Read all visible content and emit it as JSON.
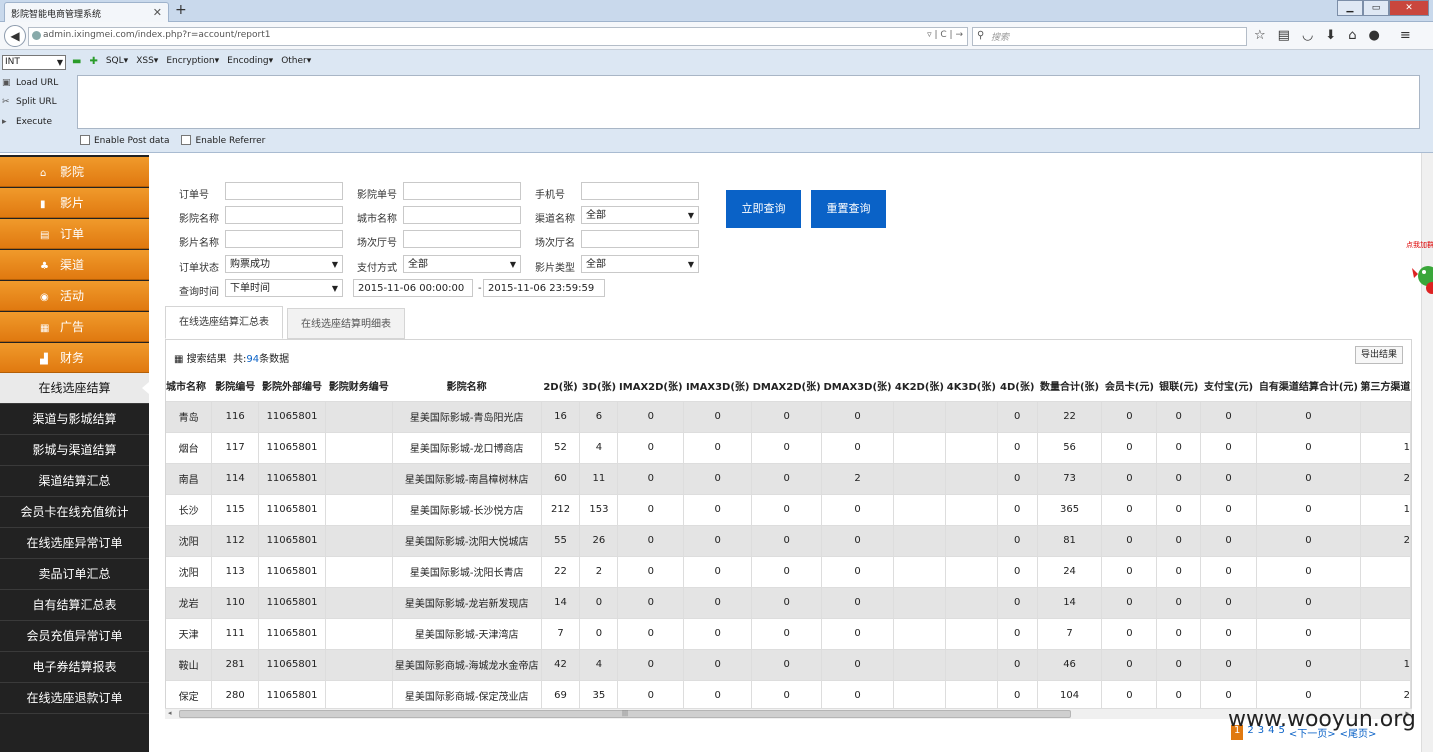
{
  "browser": {
    "tab_title": "影院智能电商管理系统",
    "url_host": "admin.ixingmei.com",
    "url_path": "/index.php?r=account/report1",
    "search_placeholder": "搜索"
  },
  "hackbar": {
    "type_select": "INT",
    "menu": [
      "SQL",
      "XSS",
      "Encryption",
      "Encoding",
      "Other"
    ],
    "actions": [
      "Load URL",
      "Split URL",
      "Execute"
    ],
    "checks": [
      "Enable Post data",
      "Enable Referrer"
    ]
  },
  "sidebar": {
    "categories": [
      {
        "label": "影院",
        "icon": "home-icon"
      },
      {
        "label": "影片",
        "icon": "film-icon"
      },
      {
        "label": "订单",
        "icon": "document-icon"
      },
      {
        "label": "渠道",
        "icon": "network-icon"
      },
      {
        "label": "活动",
        "icon": "target-icon"
      },
      {
        "label": "广告",
        "icon": "grid-icon"
      },
      {
        "label": "财务",
        "icon": "chart-icon"
      }
    ],
    "items": [
      "在线选座结算",
      "渠道与影城结算",
      "影城与渠道结算",
      "渠道结算汇总",
      "会员卡在线充值统计",
      "在线选座异常订单",
      "卖品订单汇总",
      "自有结算汇总表",
      "会员充值异常订单",
      "电子券结算报表",
      "在线选座退款订单"
    ],
    "active_index": 0
  },
  "filters": {
    "order_no": {
      "label": "订单号",
      "value": ""
    },
    "cinema_order_no": {
      "label": "影院单号",
      "value": ""
    },
    "phone": {
      "label": "手机号",
      "value": ""
    },
    "cinema_name": {
      "label": "影院名称",
      "value": ""
    },
    "city_name": {
      "label": "城市名称",
      "value": ""
    },
    "channel_name": {
      "label": "渠道名称",
      "value": "全部"
    },
    "film_name": {
      "label": "影片名称",
      "value": ""
    },
    "hall_no": {
      "label": "场次厅号",
      "value": ""
    },
    "hall_name": {
      "label": "场次厅名",
      "value": ""
    },
    "order_status": {
      "label": "订单状态",
      "value": "购票成功"
    },
    "pay_method": {
      "label": "支付方式",
      "value": "全部"
    },
    "film_type": {
      "label": "影片类型",
      "value": "全部"
    },
    "query_time": {
      "label": "查询时间",
      "value": "下单时间"
    },
    "time_from": "2015-11-06 00:00:00",
    "time_sep": "-",
    "time_to": "2015-11-06 23:59:59"
  },
  "buttons": {
    "query": "立即查询",
    "reset": "重置查询",
    "export": "导出结果"
  },
  "tabs": [
    "在线选座结算汇总表",
    "在线选座结算明细表"
  ],
  "result": {
    "label": "搜索结果",
    "count_prefix": "共:",
    "count": "94",
    "count_suffix": "条数据"
  },
  "table": {
    "headers": [
      "城市名称",
      "影院编号",
      "影院外部编号",
      "影院财务编号",
      "影院名称",
      "2D(张)",
      "3D(张)",
      "IMAX2D(张)",
      "IMAX3D(张)",
      "DMAX2D(张)",
      "DMAX3D(张)",
      "4K2D(张)",
      "4K3D(张)",
      "4D(张)",
      "数量合计(张)",
      "会员卡(元)",
      "银联(元)",
      "支付宝(元)",
      "自有渠道结算合计(元)",
      "第三方渠道"
    ],
    "rows": [
      [
        "青岛",
        "116",
        "11065801",
        "",
        "星美国际影城-青岛阳光店",
        "16",
        "6",
        "0",
        "0",
        "0",
        "0",
        "",
        "",
        "0",
        "22",
        "0",
        "0",
        "0",
        "0",
        ""
      ],
      [
        "烟台",
        "117",
        "11065801",
        "",
        "星美国际影城-龙口博商店",
        "52",
        "4",
        "0",
        "0",
        "0",
        "0",
        "",
        "",
        "0",
        "56",
        "0",
        "0",
        "0",
        "0",
        "1"
      ],
      [
        "南昌",
        "114",
        "11065801",
        "",
        "星美国际影城-南昌樟树林店",
        "60",
        "11",
        "0",
        "0",
        "0",
        "2",
        "",
        "",
        "0",
        "73",
        "0",
        "0",
        "0",
        "0",
        "2"
      ],
      [
        "长沙",
        "115",
        "11065801",
        "",
        "星美国际影城-长沙悦方店",
        "212",
        "153",
        "0",
        "0",
        "0",
        "0",
        "",
        "",
        "0",
        "365",
        "0",
        "0",
        "0",
        "0",
        "1"
      ],
      [
        "沈阳",
        "112",
        "11065801",
        "",
        "星美国际影城-沈阳大悦城店",
        "55",
        "26",
        "0",
        "0",
        "0",
        "0",
        "",
        "",
        "0",
        "81",
        "0",
        "0",
        "0",
        "0",
        "2"
      ],
      [
        "沈阳",
        "113",
        "11065801",
        "",
        "星美国际影城-沈阳长青店",
        "22",
        "2",
        "0",
        "0",
        "0",
        "0",
        "",
        "",
        "0",
        "24",
        "0",
        "0",
        "0",
        "0",
        ""
      ],
      [
        "龙岩",
        "110",
        "11065801",
        "",
        "星美国际影城-龙岩新发现店",
        "14",
        "0",
        "0",
        "0",
        "0",
        "0",
        "",
        "",
        "0",
        "14",
        "0",
        "0",
        "0",
        "0",
        ""
      ],
      [
        "天津",
        "111",
        "11065801",
        "",
        "星美国际影城-天津湾店",
        "7",
        "0",
        "0",
        "0",
        "0",
        "0",
        "",
        "",
        "0",
        "7",
        "0",
        "0",
        "0",
        "0",
        ""
      ],
      [
        "鞍山",
        "281",
        "11065801",
        "",
        "星美国际影商城-海城龙水金帝店",
        "42",
        "4",
        "0",
        "0",
        "0",
        "0",
        "",
        "",
        "0",
        "46",
        "0",
        "0",
        "0",
        "0",
        "1"
      ],
      [
        "保定",
        "280",
        "11065801",
        "",
        "星美国际影商城-保定茂业店",
        "69",
        "35",
        "0",
        "0",
        "0",
        "0",
        "",
        "",
        "0",
        "104",
        "0",
        "0",
        "0",
        "0",
        "2"
      ]
    ]
  },
  "pager": {
    "current": "1",
    "pages": [
      "2",
      "3",
      "4",
      "5"
    ],
    "next": "<下一页>",
    "last": "<尾页>"
  },
  "watermark": "www.wooyun.org",
  "float_ad": "点我加群"
}
